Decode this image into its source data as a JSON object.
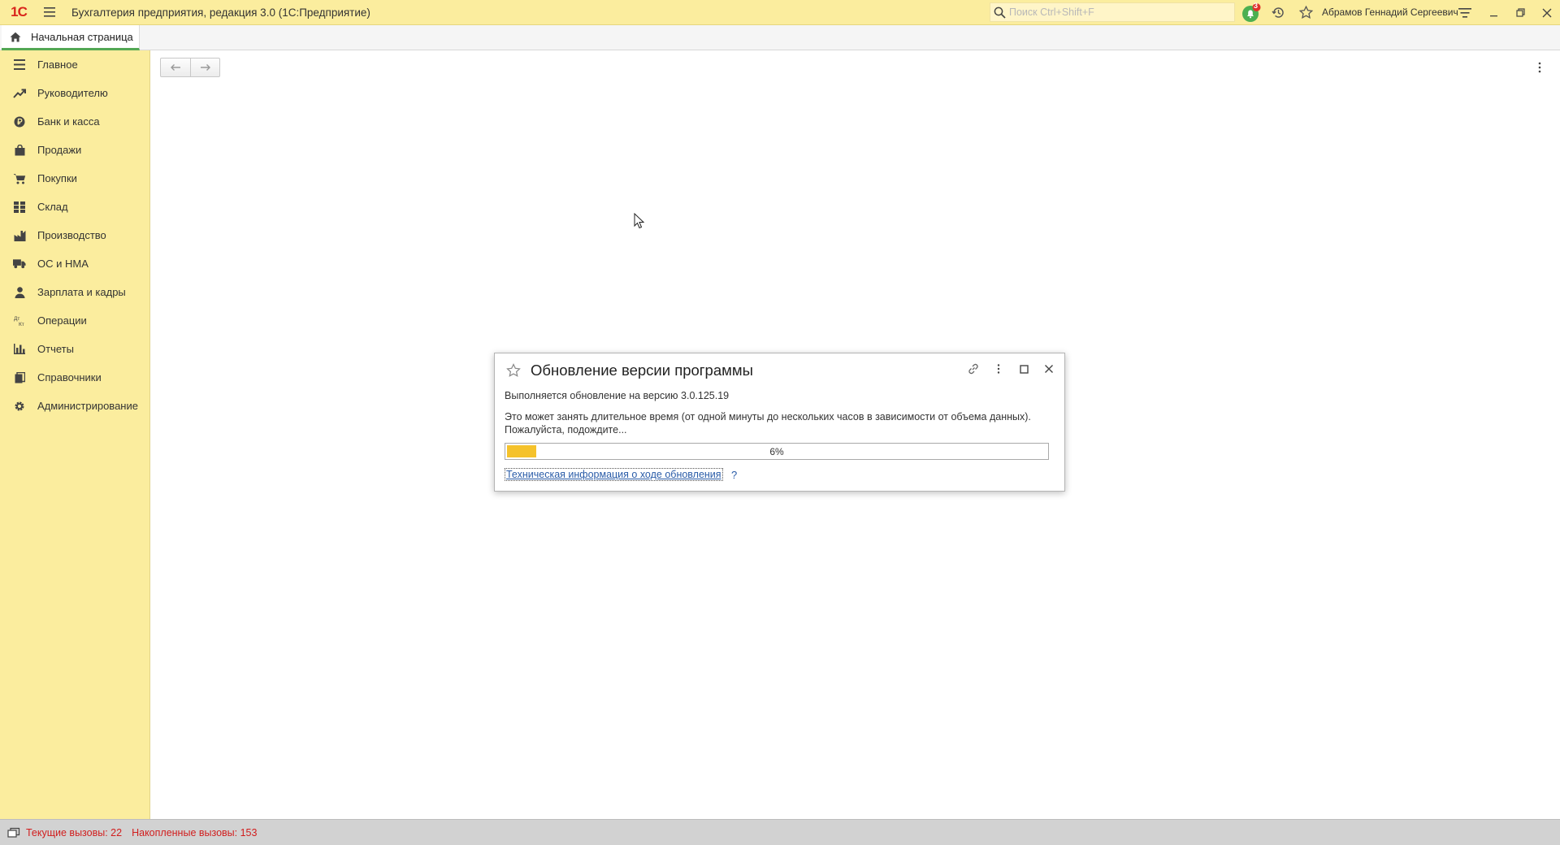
{
  "titlebar": {
    "logo": "1С",
    "title": "Бухгалтерия предприятия, редакция 3.0  (1С:Предприятие)",
    "search_placeholder": "Поиск Ctrl+Shift+F",
    "notification_count": "3",
    "user_name": "Абрамов Геннадий Сергеевич"
  },
  "tabs": {
    "home_label": "Начальная страница"
  },
  "sidebar": {
    "items": [
      {
        "label": "Главное",
        "icon": "menu-lines-icon"
      },
      {
        "label": "Руководителю",
        "icon": "trend-icon"
      },
      {
        "label": "Банк и касса",
        "icon": "ruble-coin-icon"
      },
      {
        "label": "Продажи",
        "icon": "shopping-bag-icon"
      },
      {
        "label": "Покупки",
        "icon": "cart-icon"
      },
      {
        "label": "Склад",
        "icon": "warehouse-grid-icon"
      },
      {
        "label": "Производство",
        "icon": "factory-icon"
      },
      {
        "label": "ОС и НМА",
        "icon": "truck-icon"
      },
      {
        "label": "Зарплата и кадры",
        "icon": "person-icon"
      },
      {
        "label": "Операции",
        "icon": "dt-kt-icon"
      },
      {
        "label": "Отчеты",
        "icon": "bar-chart-icon"
      },
      {
        "label": "Справочники",
        "icon": "books-icon"
      },
      {
        "label": "Администрирование",
        "icon": "gear-icon"
      }
    ]
  },
  "dialog": {
    "title": "Обновление версии программы",
    "status_line": "Выполняется обновление на версию 3.0.125.19",
    "note_line1": "Это может занять длительное время (от одной минуты до нескольких часов в зависимости от объема данных).",
    "note_line2": "Пожалуйста, подождите...",
    "progress_percent": 6,
    "progress_text": "6%",
    "tech_link": "Техническая информация о ходе обновления",
    "help": "?"
  },
  "statusbar": {
    "current_calls": "Текущие вызовы: 22",
    "accumulated_calls": "Накопленные вызовы: 153"
  },
  "colors": {
    "panel_yellow": "#fbed9e",
    "progress_fill": "#f5c22b",
    "status_red": "#d11e1e",
    "link_blue": "#2a5ca8",
    "notify_green": "#4caf50"
  }
}
